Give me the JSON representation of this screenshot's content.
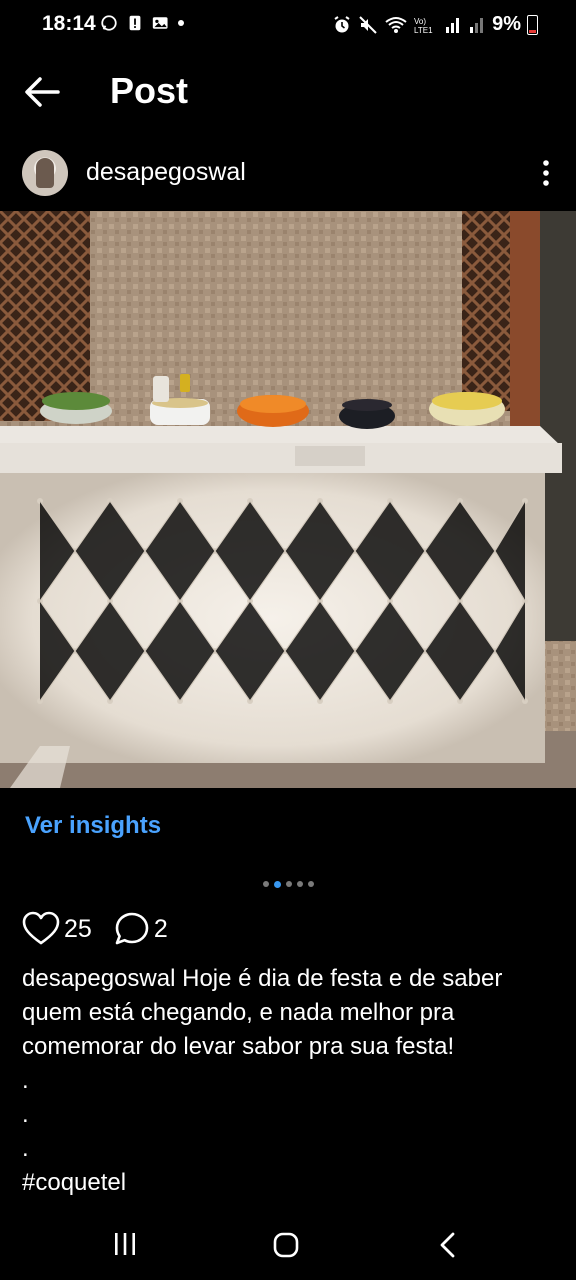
{
  "status_bar": {
    "time": "18:14",
    "battery": "9%"
  },
  "header": {
    "title": "Post"
  },
  "post": {
    "username": "desapegoswal",
    "insights_label": "Ver insights",
    "carousel": {
      "count": 5,
      "active_index": 1
    },
    "likes": "25",
    "comments": "2",
    "caption_username": "desapegoswal",
    "caption_text": "Hoje é dia de festa e de saber quem está chegando, e nada melhor pra comemorar do levar sabor pra sua festa!",
    "caption_dots": [
      ".",
      ".",
      "."
    ],
    "hashtag": "#coquetel"
  },
  "colors": {
    "background": "#000000",
    "link_blue": "#4aa3ff",
    "active_dot": "#3897f0"
  },
  "icons": [
    "back-arrow-icon",
    "more-vertical-icon",
    "heart-icon",
    "comment-icon",
    "recent-apps-icon",
    "home-icon",
    "nav-back-icon"
  ]
}
